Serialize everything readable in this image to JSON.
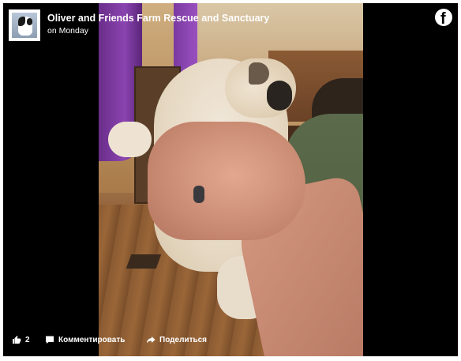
{
  "post": {
    "page_name": "Oliver and Friends Farm Rescue and Sanctuary",
    "time": "on Monday",
    "avatar_icon": "cow-avatar",
    "brand_icon": "facebook-icon",
    "brand_glyph": "f"
  },
  "actions": {
    "like_count": "2",
    "comment_label": "Комментировать",
    "share_label": "Поделиться"
  },
  "colors": {
    "background": "#000000",
    "text": "#ffffff"
  }
}
